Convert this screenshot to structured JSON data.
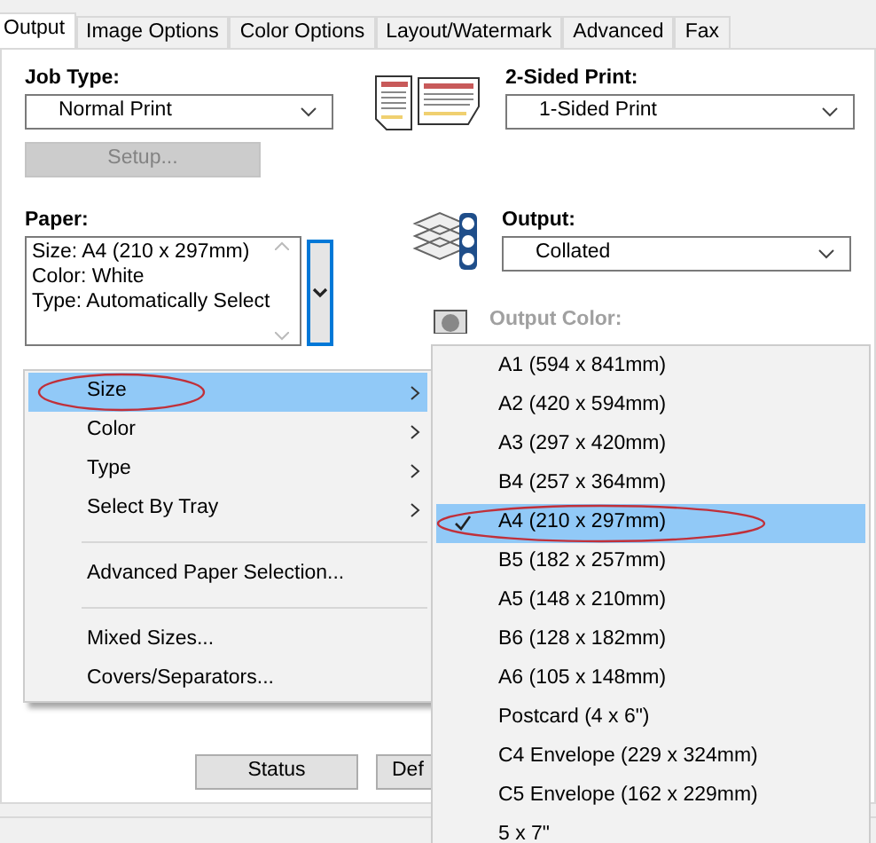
{
  "tabs": [
    {
      "label": "Output",
      "selected": true
    },
    {
      "label": "Image Options",
      "selected": false
    },
    {
      "label": "Color Options",
      "selected": false
    },
    {
      "label": "Layout/Watermark",
      "selected": false
    },
    {
      "label": "Advanced",
      "selected": false
    },
    {
      "label": "Fax",
      "selected": false
    }
  ],
  "job_type": {
    "label": "Job Type:",
    "value": "Normal Print"
  },
  "setup_button": {
    "label": "Setup...",
    "disabled": true
  },
  "two_sided": {
    "label": "2-Sided Print:",
    "value": "1-Sided Print"
  },
  "paper": {
    "label": "Paper:",
    "lines": [
      "Size: A4 (210 x 297mm)",
      "Color: White",
      "Type: Automatically Select"
    ]
  },
  "output": {
    "label": "Output:",
    "value": "Collated"
  },
  "output_color": {
    "label": "Output Color:",
    "disabled": true
  },
  "paper_menu": {
    "items": [
      {
        "kind": "item",
        "label": "Size",
        "submenu": true,
        "selected": true,
        "circled": true
      },
      {
        "kind": "item",
        "label": "Color",
        "submenu": true,
        "selected": false,
        "circled": false
      },
      {
        "kind": "item",
        "label": "Type",
        "submenu": true,
        "selected": false,
        "circled": false
      },
      {
        "kind": "item",
        "label": "Select By Tray",
        "submenu": true,
        "selected": false,
        "circled": false
      },
      {
        "kind": "separator"
      },
      {
        "kind": "item",
        "label": "Advanced Paper Selection...",
        "submenu": false,
        "selected": false,
        "circled": false
      },
      {
        "kind": "separator"
      },
      {
        "kind": "item",
        "label": "Mixed Sizes...",
        "submenu": false,
        "selected": false,
        "circled": false
      },
      {
        "kind": "item",
        "label": "Covers/Separators...",
        "submenu": false,
        "selected": false,
        "circled": false
      }
    ]
  },
  "size_menu": {
    "items": [
      {
        "label": "A1 (594 x 841mm)",
        "checked": false,
        "selected": false,
        "circled": false
      },
      {
        "label": "A2 (420 x 594mm)",
        "checked": false,
        "selected": false,
        "circled": false
      },
      {
        "label": "A3 (297 x 420mm)",
        "checked": false,
        "selected": false,
        "circled": false
      },
      {
        "label": "B4 (257 x 364mm)",
        "checked": false,
        "selected": false,
        "circled": false
      },
      {
        "label": "A4 (210 x 297mm)",
        "checked": true,
        "selected": true,
        "circled": true
      },
      {
        "label": "B5 (182 x 257mm)",
        "checked": false,
        "selected": false,
        "circled": false
      },
      {
        "label": "A5 (148 x 210mm)",
        "checked": false,
        "selected": false,
        "circled": false
      },
      {
        "label": "B6 (128 x 182mm)",
        "checked": false,
        "selected": false,
        "circled": false
      },
      {
        "label": "A6 (105 x 148mm)",
        "checked": false,
        "selected": false,
        "circled": false
      },
      {
        "label": "Postcard (4 x 6\")",
        "checked": false,
        "selected": false,
        "circled": false
      },
      {
        "label": "C4 Envelope (229 x 324mm)",
        "checked": false,
        "selected": false,
        "circled": false
      },
      {
        "label": "C5 Envelope (162 x 229mm)",
        "checked": false,
        "selected": false,
        "circled": false
      },
      {
        "label": "5 x 7\"",
        "checked": false,
        "selected": false,
        "circled": false
      }
    ]
  },
  "buttons": [
    {
      "label": "Status"
    },
    {
      "label": "Def"
    }
  ]
}
